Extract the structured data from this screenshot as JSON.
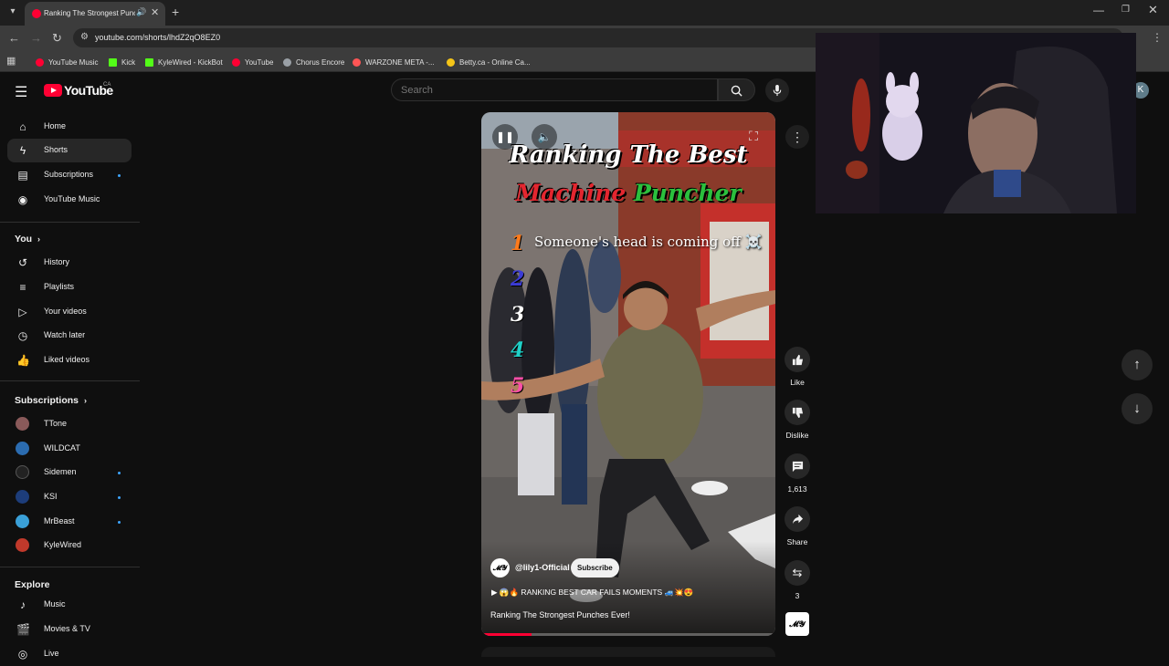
{
  "browser": {
    "tab_title": "Ranking The Strongest Punches Ever!",
    "url": "youtube.com/shorts/lhdZ2qO8EZ0",
    "bookmarks": [
      {
        "label": "YouTube Music",
        "color": "#ff0033"
      },
      {
        "label": "Kick",
        "color": "#53fc18"
      },
      {
        "label": "KyleWired - KickBot",
        "color": "#53fc18"
      },
      {
        "label": "YouTube",
        "color": "#ff0033"
      },
      {
        "label": "Chorus Encore",
        "color": "#9aa0a6"
      },
      {
        "label": "WARZONE META -...",
        "color": "#ff5555"
      },
      {
        "label": "Betty.ca - Online Ca...",
        "color": "#f5c518"
      }
    ]
  },
  "youtube": {
    "logo_text": "YouTube",
    "country": "CA",
    "search_placeholder": "Search",
    "avatar_letter": "K"
  },
  "sidebar": {
    "main": [
      {
        "label": "Home",
        "icon": "home-icon"
      },
      {
        "label": "Shorts",
        "icon": "shorts-icon",
        "active": true
      },
      {
        "label": "Subscriptions",
        "icon": "subscriptions-icon",
        "dot": true
      },
      {
        "label": "YouTube Music",
        "icon": "youtube-music-icon"
      }
    ],
    "you_heading": "You",
    "you": [
      {
        "label": "History",
        "icon": "history-icon"
      },
      {
        "label": "Playlists",
        "icon": "playlists-icon"
      },
      {
        "label": "Your videos",
        "icon": "your-videos-icon"
      },
      {
        "label": "Watch later",
        "icon": "watch-later-icon"
      },
      {
        "label": "Liked videos",
        "icon": "liked-videos-icon"
      }
    ],
    "subs_heading": "Subscriptions",
    "subs": [
      {
        "label": "TTone",
        "color": "#8a5a5a"
      },
      {
        "label": "WILDCAT",
        "color": "#2b6cb0"
      },
      {
        "label": "Sidemen",
        "color": "#222222",
        "dot": true
      },
      {
        "label": "KSI",
        "color": "#1d3d7a",
        "dot": true
      },
      {
        "label": "MrBeast",
        "color": "#3aa0d8",
        "dot": true
      },
      {
        "label": "KyleWired",
        "color": "#c0392b"
      }
    ],
    "explore_heading": "Explore",
    "explore": [
      {
        "label": "Music",
        "icon": "music-icon"
      },
      {
        "label": "Movies & TV",
        "icon": "movies-icon"
      },
      {
        "label": "Live",
        "icon": "live-icon"
      }
    ]
  },
  "short": {
    "overlay_title_line1": "Ranking The Best",
    "overlay_title_line2_a": "Machine",
    "overlay_title_line2_b": "Puncher",
    "ranks": [
      {
        "num": "1",
        "color": "#ff7a1a"
      },
      {
        "num": "2",
        "color": "#3b3bd6"
      },
      {
        "num": "3",
        "color": "#ffffff"
      },
      {
        "num": "4",
        "color": "#1fd1c8"
      },
      {
        "num": "5",
        "color": "#ff4fa8"
      }
    ],
    "rank1_text": "Someone's head is coming off ☠️",
    "channel_avatar_text": "𝓜𝓨",
    "channel": "@lily1-Official",
    "subscribe_label": "Subscribe",
    "playlist": "▶ 😱🔥 RANKING BEST CAR FAILS MOMENTS 🚙💥😍",
    "title": "Ranking The Strongest Punches Ever!",
    "progress": 0.17
  },
  "actions": {
    "like_label": "Like",
    "dislike_label": "Dislike",
    "comments_count": "1,613",
    "share_label": "Share",
    "remix_count": "3"
  }
}
